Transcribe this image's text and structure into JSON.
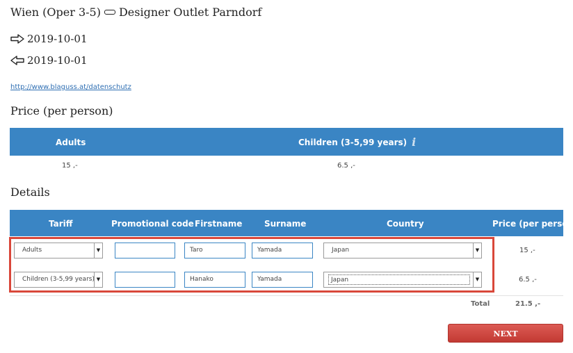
{
  "route": {
    "from": "Wien (Oper 3-5)",
    "to": "Designer Outlet Parndorf"
  },
  "dates": {
    "outbound": "2019-10-01",
    "return": "2019-10-01"
  },
  "privacy_link": "http://www.blaguss.at/datenschutz",
  "price_section": {
    "title": "Price (per person)",
    "headers": {
      "adults": "Adults",
      "children": "Children (3-5,99 years)"
    },
    "values": {
      "adults": "15 ,-",
      "children": "6.5 ,-"
    }
  },
  "details_section": {
    "title": "Details",
    "headers": {
      "tariff": "Tariff",
      "promo": "Promotional code",
      "firstname": "Firstname",
      "surname": "Surname",
      "country": "Country",
      "price": "Price (per person)"
    },
    "rows": [
      {
        "tariff": "Adults",
        "promo": "",
        "firstname": "Taro",
        "surname": "Yamada",
        "country": "Japan",
        "price": "15 ,-"
      },
      {
        "tariff": "Children (3-5,99 years)",
        "promo": "",
        "firstname": "Hanako",
        "surname": "Yamada",
        "country": "Japan",
        "price": "6.5 ,-"
      }
    ],
    "total_label": "Total",
    "total_value": "21.5 ,-"
  },
  "next_button": "NEXT",
  "colors": {
    "header_blue": "#3a85c4",
    "highlight_red": "#d9473a",
    "button_red": "#c23a33"
  }
}
